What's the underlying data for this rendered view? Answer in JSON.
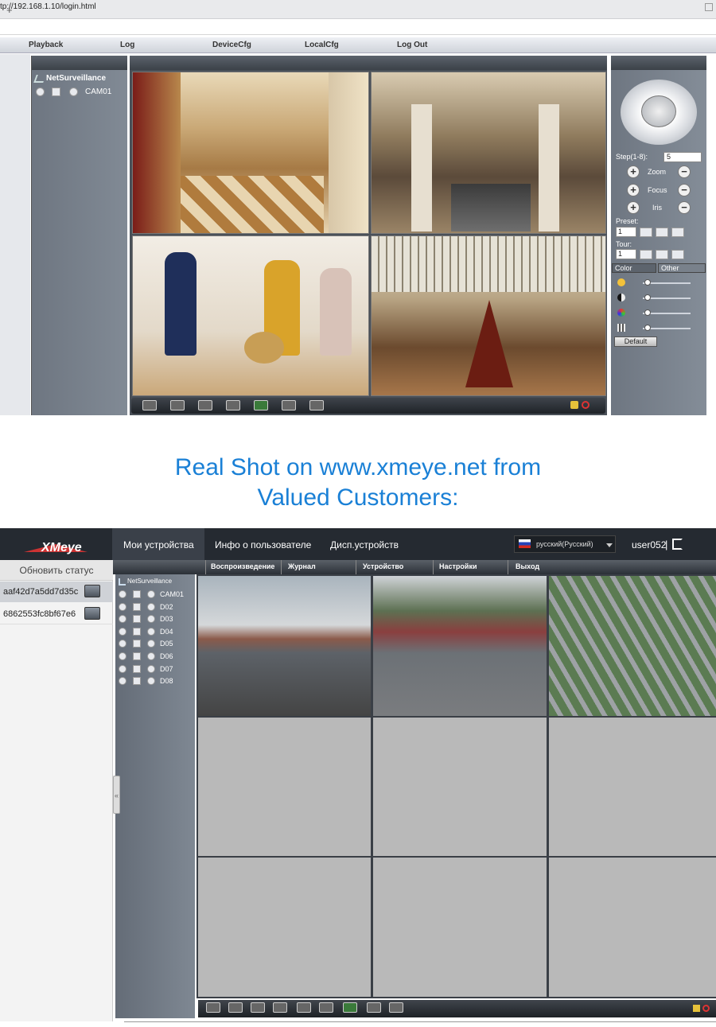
{
  "browser": {
    "new_tab": "+",
    "url": "tp://192.168.1.10/login.html"
  },
  "top_app": {
    "menu": [
      "Playback",
      "Log",
      "DeviceCfg",
      "LocalCfg",
      "Log Out"
    ],
    "tree_title": "NetSurveillance",
    "channel": "CAM01",
    "ptz": {
      "step_label": "Step(1-8):",
      "step_value": "5",
      "zoom": "Zoom",
      "focus": "Focus",
      "iris": "Iris",
      "preset": "Preset:",
      "preset_value": "1",
      "tour": "Tour:",
      "tour_value": "1",
      "tab_color": "Color",
      "tab_other": "Other",
      "default": "Default"
    }
  },
  "tagline": {
    "line1": "Real Shot on www.xmeye.net from",
    "line2": "Valued Customers:"
  },
  "bottom_app": {
    "logo": "XMeye",
    "nav": [
      "Мои устройства",
      "Инфо о пользователе",
      "Дисп.устройств"
    ],
    "language": "русский(Русский)",
    "user": "user052",
    "separator": "|",
    "refresh": "Обновить статус",
    "devices": [
      "aaf42d7a5dd7d35c",
      "6862553fc8bf67e6"
    ],
    "menu": [
      "Воспроизведение",
      "Журнал",
      "Устройство",
      "Настройки",
      "Выход"
    ],
    "tree_title": "NetSurveillance",
    "channels": [
      "CAM01",
      "D02",
      "D03",
      "D04",
      "D05",
      "D06",
      "D07",
      "D08"
    ],
    "collapse_glyph": "«"
  },
  "colors": {
    "tagline": "#1a80d6",
    "dark_header": "#252a31",
    "panel_grey": "#747c87"
  }
}
